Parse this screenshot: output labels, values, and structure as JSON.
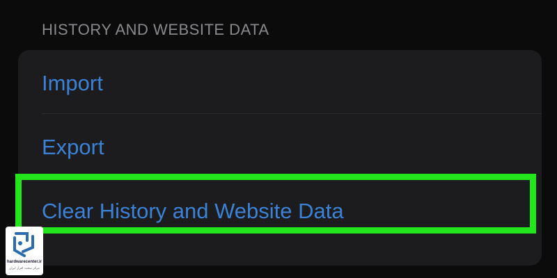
{
  "section": {
    "header": "HISTORY AND WEBSITE DATA"
  },
  "rows": {
    "import_label": "Import",
    "export_label": "Export",
    "clear_label": "Clear History and Website Data"
  },
  "colors": {
    "background": "#0b0b0c",
    "group_background": "#1c1c1e",
    "link_blue": "#3b82d6",
    "highlight_green": "#22e51c",
    "header_gray": "#8a8a8e"
  },
  "watermark": {
    "brand": "hardwarecenter.ir",
    "tagline": "مرکز سخت افزار ایران",
    "icon": "hardwarecenter-logo-icon"
  }
}
